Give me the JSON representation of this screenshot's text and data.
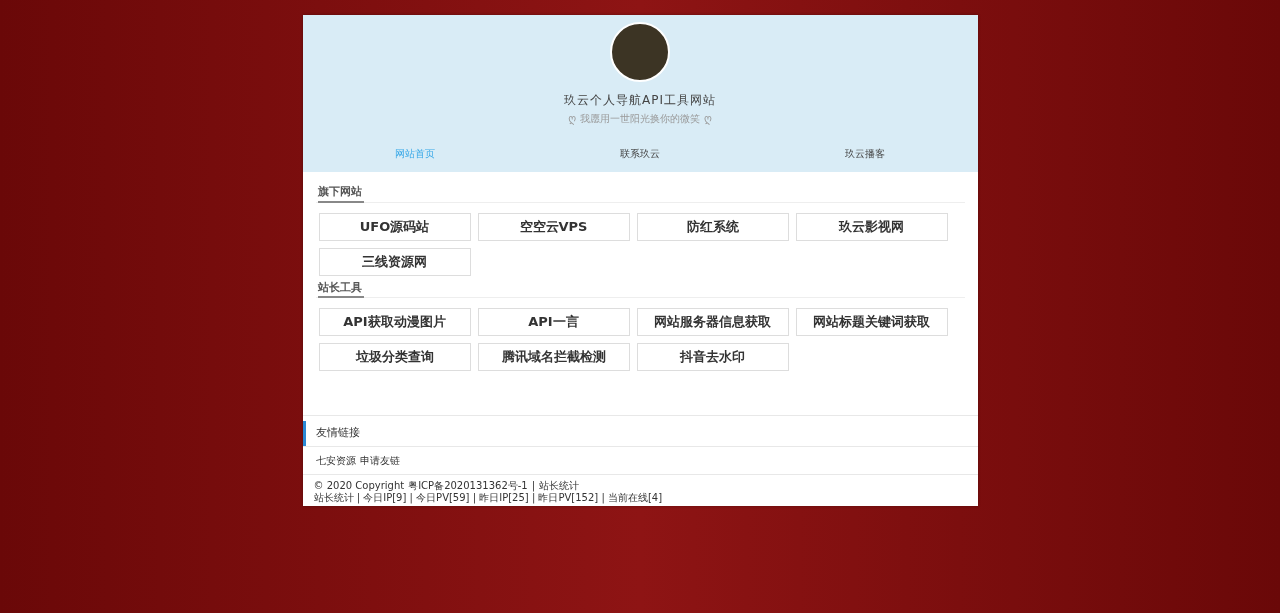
{
  "header": {
    "title": "玖云个人导航API工具网站",
    "motto_left": "ღ",
    "motto": "我愿用一世阳光换你的微笑",
    "motto_right": "ღ"
  },
  "nav": [
    {
      "label": "网站首页",
      "selected": true
    },
    {
      "label": "联系玖云",
      "selected": false
    },
    {
      "label": "玖云播客",
      "selected": false
    }
  ],
  "sections": [
    {
      "title": "旗下网站",
      "links": [
        "UFO源码站",
        "空空云VPS",
        "防红系统",
        "玖云影视网",
        "三线资源网"
      ]
    },
    {
      "title": "站长工具",
      "links": [
        "API获取动漫图片",
        "API一言",
        "网站服务器信息获取",
        "网站标题关键词获取",
        "垃圾分类查询",
        "腾讯域名拦截检测",
        "抖音去水印"
      ]
    }
  ],
  "friend_links": {
    "title": "友情链接",
    "links": [
      "七安资源",
      "申请友链"
    ]
  },
  "footer": {
    "copyright": "© 2020 Copyright",
    "icp": "粤ICP备2020131362号-1",
    "separator": "|",
    "stats_link": "站长统计",
    "stats": "站长统计 | 今日IP[9] | 今日PV[59] | 昨日IP[25] | 昨日PV[152] | 当前在线[4]"
  }
}
